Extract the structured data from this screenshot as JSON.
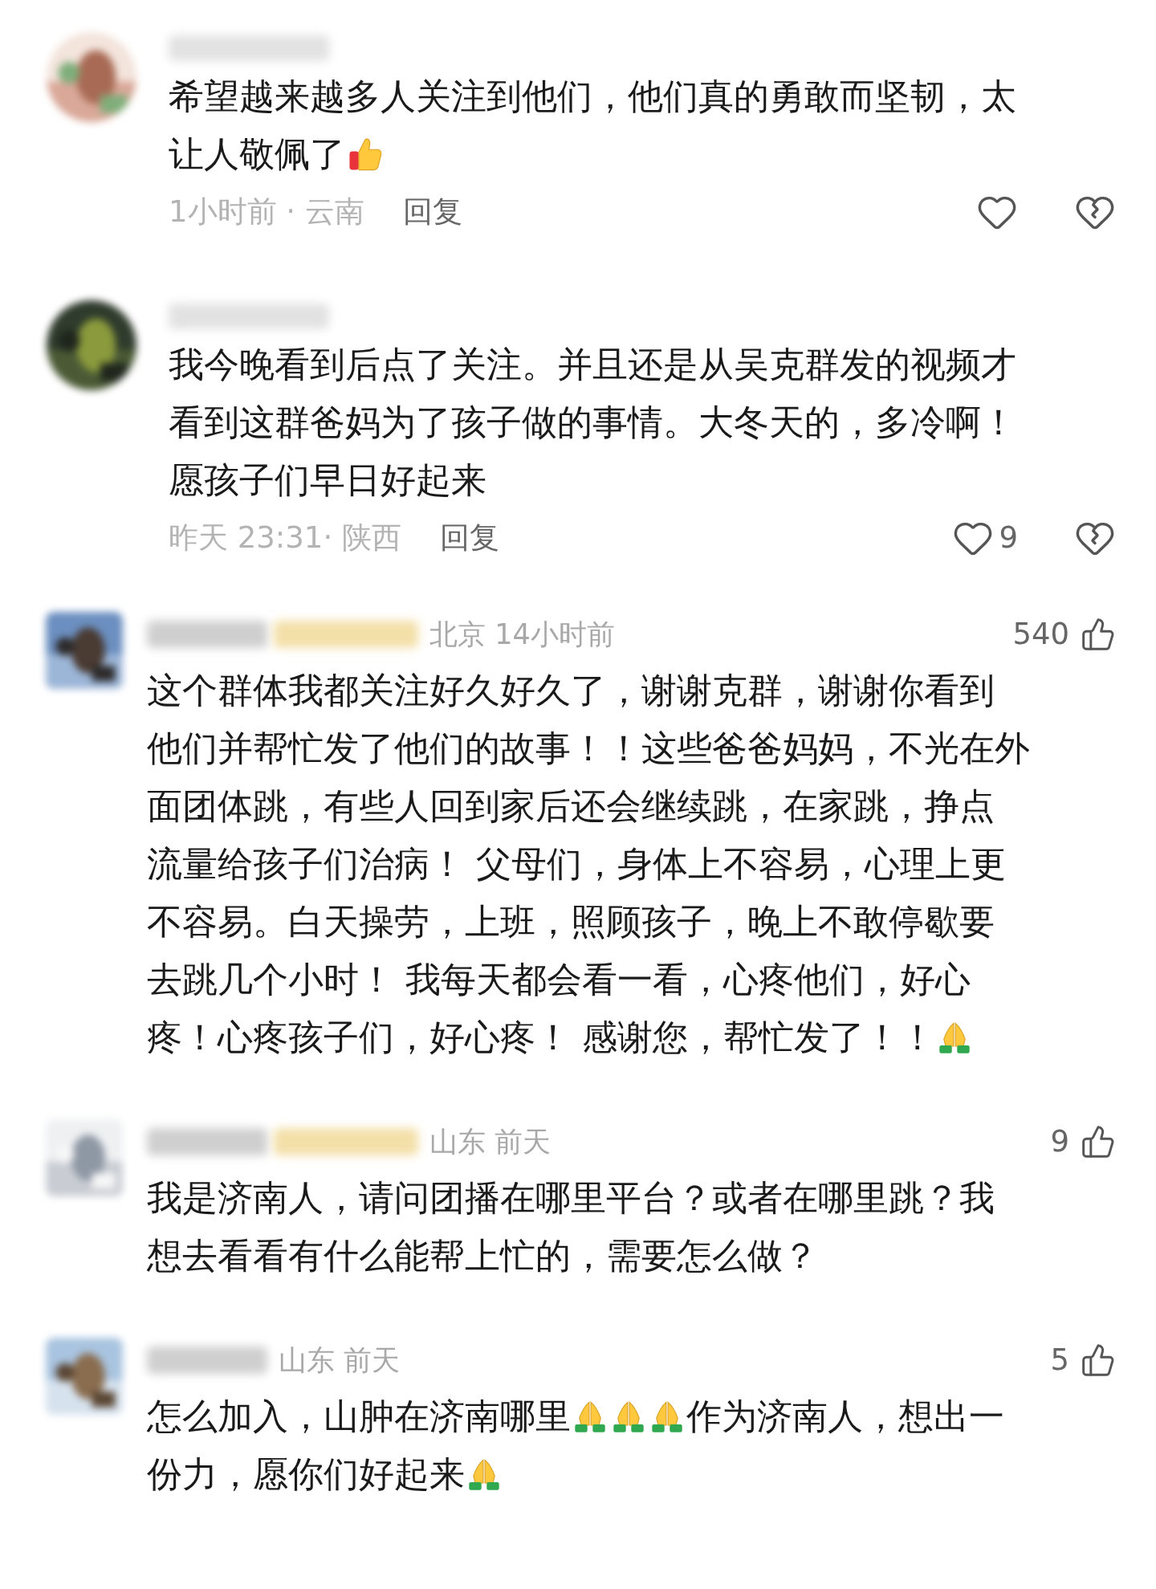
{
  "comments": [
    {
      "kind": "threaded",
      "lines": [
        [
          {
            "kind": "text",
            "text": "希望越来越多人关注到他们，他们真的勇敢而坚韧，太"
          }
        ],
        [
          {
            "kind": "text",
            "text": "让人敬佩了"
          },
          {
            "kind": "thumbs-up"
          }
        ]
      ],
      "time_place": "1小时前 · 云南",
      "reply": "回复"
    },
    {
      "kind": "threaded",
      "lines": [
        [
          {
            "kind": "text",
            "text": "我今晚看到后点了关注。并且还是从吴克群发的视频才"
          }
        ],
        [
          {
            "kind": "text",
            "text": "看到这群爸妈为了孩子做的事情。大冬天的，多冷啊！"
          }
        ],
        [
          {
            "kind": "text",
            "text": "愿孩子们早日好起来"
          }
        ]
      ],
      "time_place": "昨天 23:31· 陕西",
      "reply": "回复",
      "likes": "9"
    },
    {
      "kind": "compact",
      "badge": true,
      "place_time": "北京 14小时前",
      "likes": "540",
      "lines": [
        [
          {
            "kind": "text",
            "text": "这个群体我都关注好久好久了，谢谢克群，谢谢你看到"
          }
        ],
        [
          {
            "kind": "text",
            "text": "他们并帮忙发了他们的故事！！这些爸爸妈妈，不光在外"
          }
        ],
        [
          {
            "kind": "text",
            "text": "面团体跳，有些人回到家后还会继续跳，在家跳，挣点"
          }
        ],
        [
          {
            "kind": "text",
            "text": "流量给孩子们治病！ 父母们，身体上不容易，心理上更"
          }
        ],
        [
          {
            "kind": "text",
            "text": "不容易。白天操劳，上班，照顾孩子，晚上不敢停歇要"
          }
        ],
        [
          {
            "kind": "text",
            "text": "去跳几个小时！ 我每天都会看一看，心疼他们，好心"
          }
        ],
        [
          {
            "kind": "text",
            "text": "疼！心疼孩子们，好心疼！ 感谢您，帮忙发了！！"
          },
          {
            "kind": "pray"
          }
        ]
      ]
    },
    {
      "kind": "compact",
      "badge": true,
      "place_time": "山东 前天",
      "likes": "9",
      "lines": [
        [
          {
            "kind": "text",
            "text": "我是济南人，请问团播在哪里平台？或者在哪里跳？我"
          }
        ],
        [
          {
            "kind": "text",
            "text": "想去看看有什么能帮上忙的，需要怎么做？"
          }
        ]
      ]
    },
    {
      "kind": "compact",
      "badge": false,
      "place_time": "山东 前天",
      "likes": "5",
      "lines": [
        [
          {
            "kind": "text",
            "text": "怎么加入，山肿在济南哪里"
          },
          {
            "kind": "pray"
          },
          {
            "kind": "pray"
          },
          {
            "kind": "pray"
          },
          {
            "kind": "text",
            "text": "作为济南人，想出一"
          }
        ],
        [
          {
            "kind": "text",
            "text": "份力，愿你们好起来"
          },
          {
            "kind": "pray"
          }
        ]
      ]
    }
  ]
}
